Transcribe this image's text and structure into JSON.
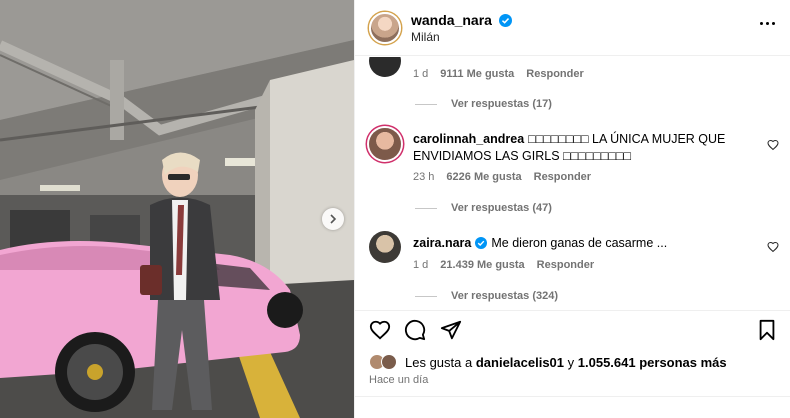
{
  "post": {
    "username": "wanda_nara",
    "location": "Milán"
  },
  "comments": [
    {
      "time": "1 d",
      "likes": "9111 Me gusta",
      "reply": "Responder",
      "view_replies": "Ver respuestas (17)"
    },
    {
      "username": "carolinnah_andrea",
      "text": "□□□□□□□□ LA ÚNICA MUJER QUE ENVIDIAMOS LAS GIRLS □□□□□□□□□",
      "time": "23 h",
      "likes": "6226 Me gusta",
      "reply": "Responder",
      "view_replies": "Ver respuestas (47)"
    },
    {
      "username": "zaira.nara",
      "text": "Me dieron ganas de casarme ...",
      "time": "1 d",
      "likes": "21.439 Me gusta",
      "reply": "Responder",
      "view_replies": "Ver respuestas (324)"
    }
  ],
  "likes": {
    "prefix": "Les gusta a",
    "user": "danielacelis01",
    "joiner": "y",
    "count": "1.055.641 personas más"
  },
  "time_ago": "Hace un día",
  "colors": {
    "verified": "#0095f6",
    "car": "#f2a6d2",
    "secondary_text": "#737373"
  },
  "icons": [
    "heart-icon",
    "comment-icon",
    "share-icon",
    "bookmark-icon",
    "more-icon",
    "chevron-right-icon",
    "verified-icon"
  ]
}
